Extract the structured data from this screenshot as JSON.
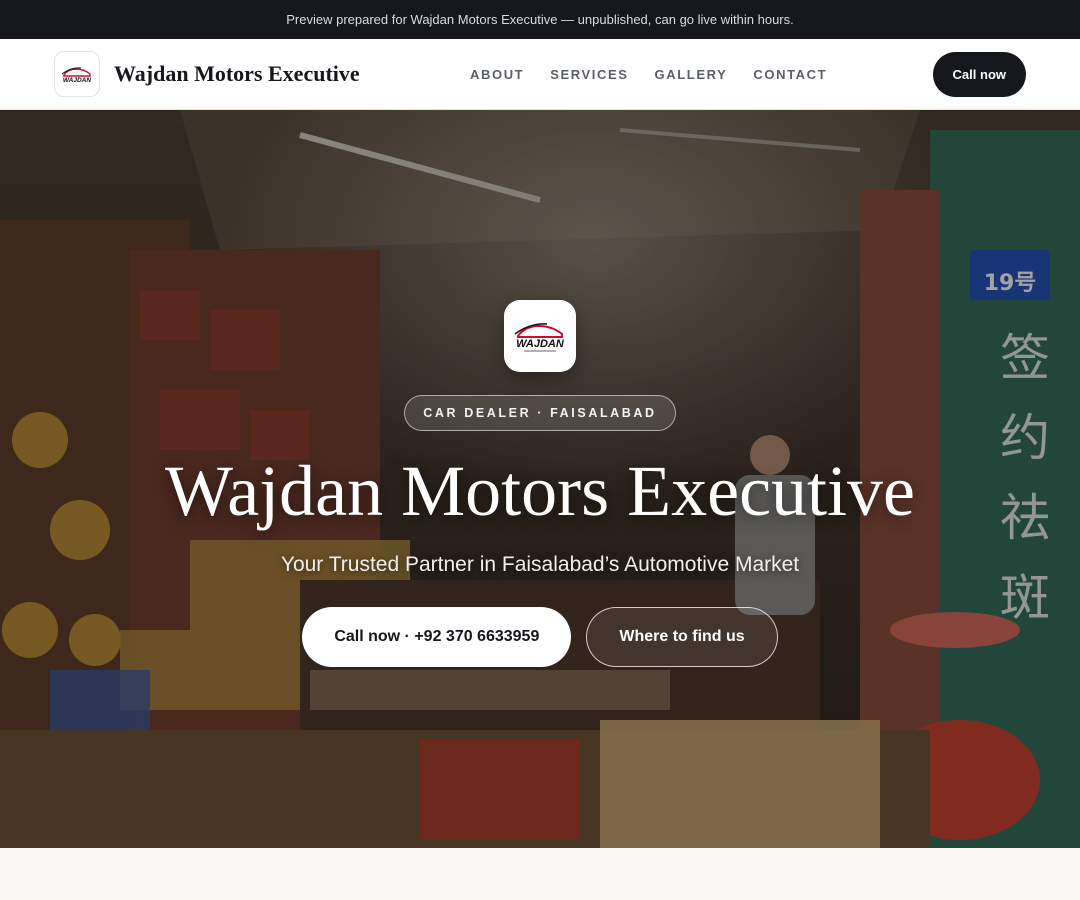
{
  "banner": {
    "text": "Preview prepared for Wajdan Motors Executive — unpublished, can go live within hours."
  },
  "header": {
    "brand": "Wajdan Motors Executive",
    "logo_text": "WAJDAN",
    "nav": [
      "ABOUT",
      "SERVICES",
      "GALLERY",
      "CONTACT"
    ],
    "call_label": "Call now"
  },
  "hero": {
    "tag": "CAR DEALER · FAISALABAD",
    "title": "Wajdan Motors Executive",
    "subtitle": "Your Trusted Partner in Faisalabad’s Automotive Market",
    "primary_cta": "Call now · +92 370 6633959",
    "secondary_cta": "Where to find us",
    "sign_number": "19号",
    "sign_chars": [
      "签",
      "约",
      "祛",
      "斑"
    ]
  },
  "colors": {
    "dark": "#15171c",
    "accent_red": "#c8102e",
    "sign_blue": "#1f4fb8"
  }
}
